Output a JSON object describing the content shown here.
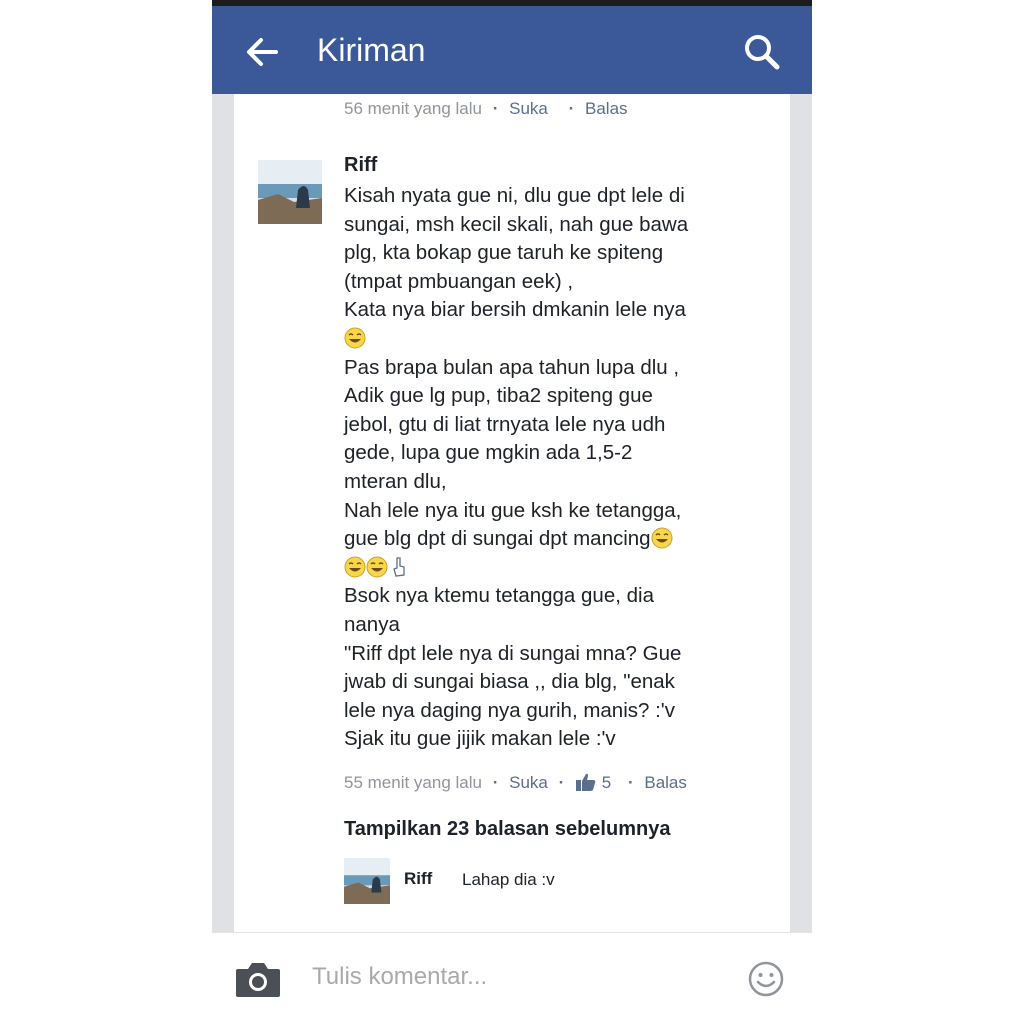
{
  "header": {
    "title": "Kiriman",
    "back_icon": "arrow-left-icon",
    "search_icon": "search-icon",
    "background": "#3b5998"
  },
  "prev_comment": {
    "time": "56 menit yang lalu",
    "like_label": "Suka",
    "reply_label": "Balas"
  },
  "comment": {
    "author": "Riff",
    "text_blocks": [
      "Kisah nyata gue ni, dlu gue dpt lele di\nsungai, msh kecil skali, nah gue bawa\nplg, kta bokap gue taruh ke spiteng\n(tmpat pmbuangan eek) ,\nKata nya biar bersih dmkanin lele nya",
      "Pas brapa bulan apa tahun lupa dlu ,\nAdik gue lg pup, tiba2 spiteng gue\njebol, gtu di liat trnyata lele nya udh\ngede, lupa gue mgkin ada 1,5-2\nmteran dlu,\nNah lele nya itu gue ksh ke tetangga,\ngue blg dpt di sungai dpt mancing",
      "Bsok nya ktemu tetangga gue, dia\nnanya\n\"Riff dpt lele nya di sungai mna? Gue\njwab di sungai biasa ,, dia blg, \"enak\nlele nya daging nya gurih, manis? :'v\nSjak itu gue jijik makan lele :'v"
    ],
    "time": "55 menit yang lalu",
    "like_label": "Suka",
    "like_count": "5",
    "reply_label": "Balas"
  },
  "more_replies_label": "Tampilkan 23 balasan sebelumnya",
  "reply": {
    "author": "Riff",
    "text": "Lahap dia :v"
  },
  "composer": {
    "placeholder": "Tulis komentar...",
    "camera_icon": "camera-icon",
    "emoji_icon": "smiley-icon"
  }
}
